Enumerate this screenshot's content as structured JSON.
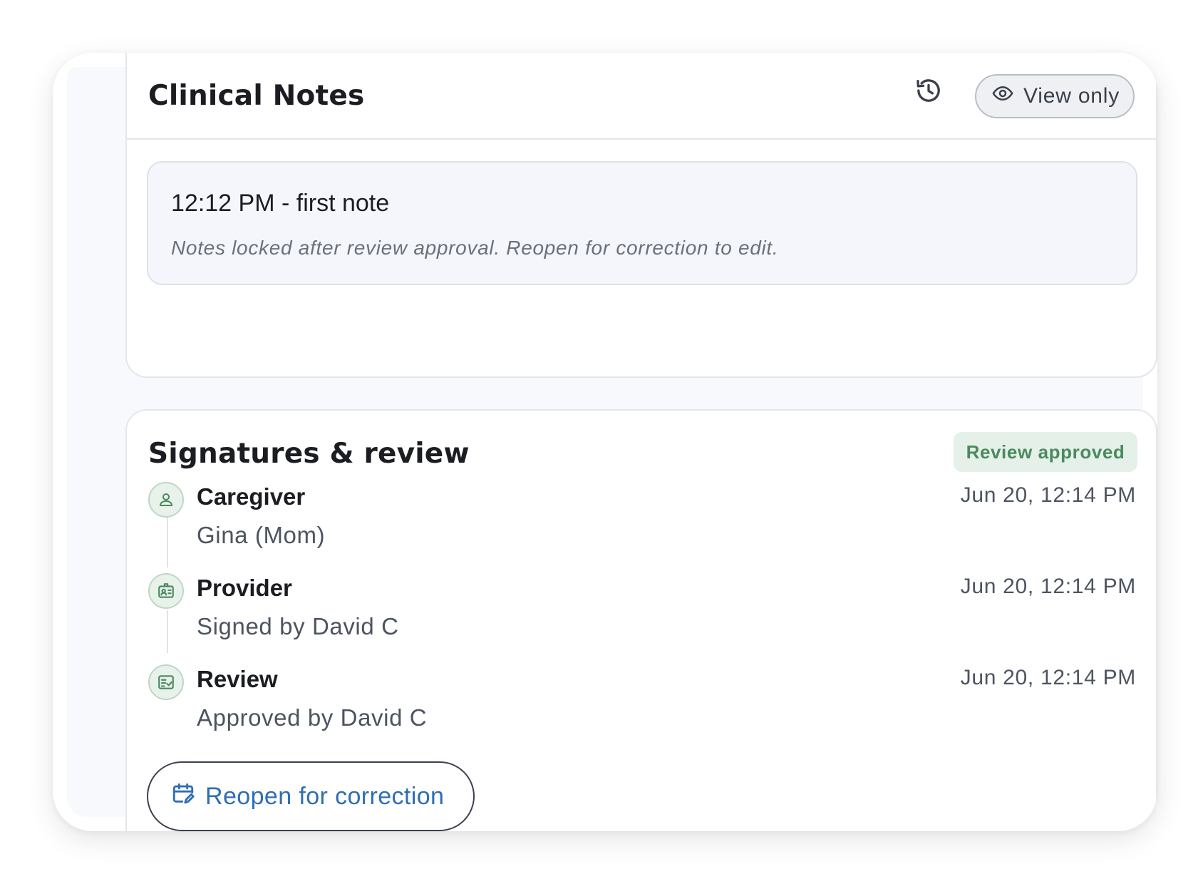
{
  "clinical_notes": {
    "title": "Clinical Notes",
    "history_icon": "history-icon",
    "view_only_label": "View only",
    "view_only_icon": "eye-icon",
    "note_text": "12:12 PM - first note",
    "lock_message": "Notes locked after review approval. Reopen for correction to edit."
  },
  "signatures": {
    "title": "Signatures & review",
    "status_badge": "Review approved",
    "steps": [
      {
        "icon": "person-icon",
        "title": "Caregiver",
        "subtitle": "Gina (Mom)",
        "time": "Jun 20, 12:14 PM"
      },
      {
        "icon": "id-badge-icon",
        "title": "Provider",
        "subtitle": "Signed by David C",
        "time": "Jun 20, 12:14 PM"
      },
      {
        "icon": "checklist-icon",
        "title": "Review",
        "subtitle": "Approved by David C",
        "time": "Jun 20, 12:14 PM"
      }
    ],
    "reopen_label": "Reopen for correction",
    "reopen_icon": "calendar-edit-icon"
  },
  "colors": {
    "accent_green": "#4a8a5f",
    "badge_bg": "#e5f0e8",
    "link_blue": "#2f6db6"
  }
}
